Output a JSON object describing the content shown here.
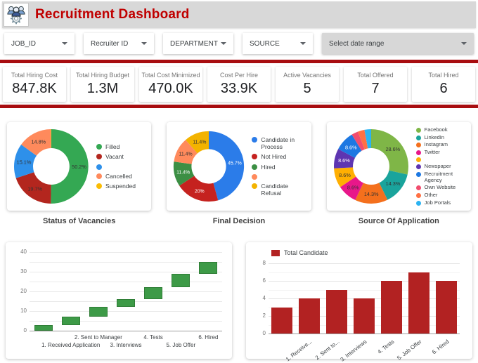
{
  "colors": {
    "accent_red": "#a80d10",
    "title_red": "#c00000",
    "header_bg": "#d8d8d8"
  },
  "icons": {
    "header": "team-gear-icon",
    "dropdown": "chevron-down-icon"
  },
  "header": {
    "title": "Recruitment Dashboard"
  },
  "filters": [
    {
      "label": "JOB_ID",
      "variant": "light"
    },
    {
      "label": "Recruiter ID",
      "variant": "light"
    },
    {
      "label": "DEPARTMENT",
      "variant": "light"
    },
    {
      "label": "SOURCE",
      "variant": "light"
    },
    {
      "label": "Select date range",
      "variant": "filled"
    }
  ],
  "kpis": [
    {
      "label": "Total Hiring Cost",
      "value": "847.8K"
    },
    {
      "label": "Total Hiring Budget",
      "value": "1.3M"
    },
    {
      "label": "Total Cost Minimized",
      "value": "470.0K"
    },
    {
      "label": "Cost Per Hire",
      "value": "33.9K"
    },
    {
      "label": "Active Vacancies",
      "value": "5"
    },
    {
      "label": "Total Offered",
      "value": "7"
    },
    {
      "label": "Total Hired",
      "value": "6"
    }
  ],
  "chart_data": [
    {
      "type": "pie",
      "donut": true,
      "title": "Status of Vacancies",
      "legend_position": "right",
      "slices": [
        {
          "label": "Filled",
          "value": 50.2,
          "color": "#34A853",
          "text": "50.2%",
          "text_color": "#333333"
        },
        {
          "label": "Vacant",
          "value": 19.7,
          "color": "#B3261E",
          "text": "19.7%",
          "text_color": "#333333"
        },
        {
          "label": "",
          "value": 15.1,
          "color": "#2E90EA",
          "text": "15.1%",
          "text_color": "#333333"
        },
        {
          "label": "Cancelled",
          "value": 14.8,
          "color": "#FF8A5C",
          "text": "14.8%",
          "text_color": "#333333"
        },
        {
          "label": "Suspended",
          "value": 0.2,
          "color": "#FBBC04",
          "text": "",
          "text_color": ""
        }
      ]
    },
    {
      "type": "pie",
      "donut": true,
      "title": "Final Decision",
      "legend_position": "right",
      "slices": [
        {
          "label": "Candidate in Process",
          "value": 45.7,
          "color": "#2B7CE9",
          "text": "45.7%",
          "text_color": "#ffffff"
        },
        {
          "label": "Not Hired",
          "value": 20.0,
          "color": "#C5221F",
          "text": "20%",
          "text_color": "#ffffff"
        },
        {
          "label": "Hired",
          "value": 11.4,
          "color": "#3C8F44",
          "text": "11.4%",
          "text_color": "#ffffff"
        },
        {
          "label": "",
          "value": 11.4,
          "color": "#FF8A5C",
          "text": "11.4%",
          "text_color": "#333333"
        },
        {
          "label": "Candidate Refusal",
          "value": 11.4,
          "color": "#F3B300",
          "text": "11.4%",
          "text_color": "#333333"
        }
      ]
    },
    {
      "type": "pie",
      "donut": true,
      "title": "Source Of Application",
      "legend_position": "right",
      "legend_size": "small",
      "slices": [
        {
          "label": "Facebook",
          "value": 28.6,
          "color": "#7FB647",
          "text": "28.6%",
          "text_color": "#333333"
        },
        {
          "label": "LinkedIn",
          "value": 14.3,
          "color": "#1AA49C",
          "text": "14.3%",
          "text_color": "#333333"
        },
        {
          "label": "Instagram",
          "value": 14.3,
          "color": "#F4701D",
          "text": "14.3%",
          "text_color": "#333333"
        },
        {
          "label": "Twitter",
          "value": 8.6,
          "color": "#E8178A",
          "text": "8.6%",
          "text_color": "#333333"
        },
        {
          "label": "",
          "value": 8.6,
          "color": "#FFAF02",
          "text": "8.6%",
          "text_color": "#333333"
        },
        {
          "label": "Newspaper",
          "value": 8.6,
          "color": "#5E35B1",
          "text": "8.6%",
          "text_color": "#ffffff"
        },
        {
          "label": "Recruitment Agency",
          "value": 8.6,
          "color": "#1D78E2",
          "text": "8.6%",
          "text_color": "#ffffff"
        },
        {
          "label": "Own Website",
          "value": 2.9,
          "color": "#F14D6E",
          "text": "",
          "text_color": ""
        },
        {
          "label": "Other",
          "value": 2.9,
          "color": "#FF7043",
          "text": "",
          "text_color": ""
        },
        {
          "label": "Job Portals",
          "value": 2.9,
          "color": "#2CB3F1",
          "text": "",
          "text_color": ""
        }
      ]
    },
    {
      "type": "candlestick",
      "title": "",
      "categories": [
        "",
        "1. Received Application",
        "2. Sent to Manager",
        "3. Interviews",
        "4. Tests",
        "5. Job Offer",
        "6. Hired"
      ],
      "ranges": [
        [
          0,
          3
        ],
        [
          3,
          7
        ],
        [
          7,
          12
        ],
        [
          12,
          16
        ],
        [
          16,
          22
        ],
        [
          22,
          29
        ],
        [
          29,
          35
        ]
      ],
      "ylim": [
        0,
        40
      ],
      "grid_step": 5,
      "tick_step": 10,
      "box_color": "#3D9A47",
      "box_border": "#2F7D36",
      "staggered_labels": true
    },
    {
      "type": "bar",
      "legend": "Total Candidate",
      "categories": [
        "",
        "1. Receive...",
        "2. Sent to...",
        "3. Interviews",
        "4. Tests",
        "5. Job Offer",
        "6. Hired"
      ],
      "values": [
        3,
        4,
        5,
        4,
        6,
        7,
        6
      ],
      "ylim": [
        0,
        8
      ],
      "grid_step": 1,
      "tick_step": 2,
      "bar_color": "#B22222",
      "label_rotation": -38
    }
  ]
}
